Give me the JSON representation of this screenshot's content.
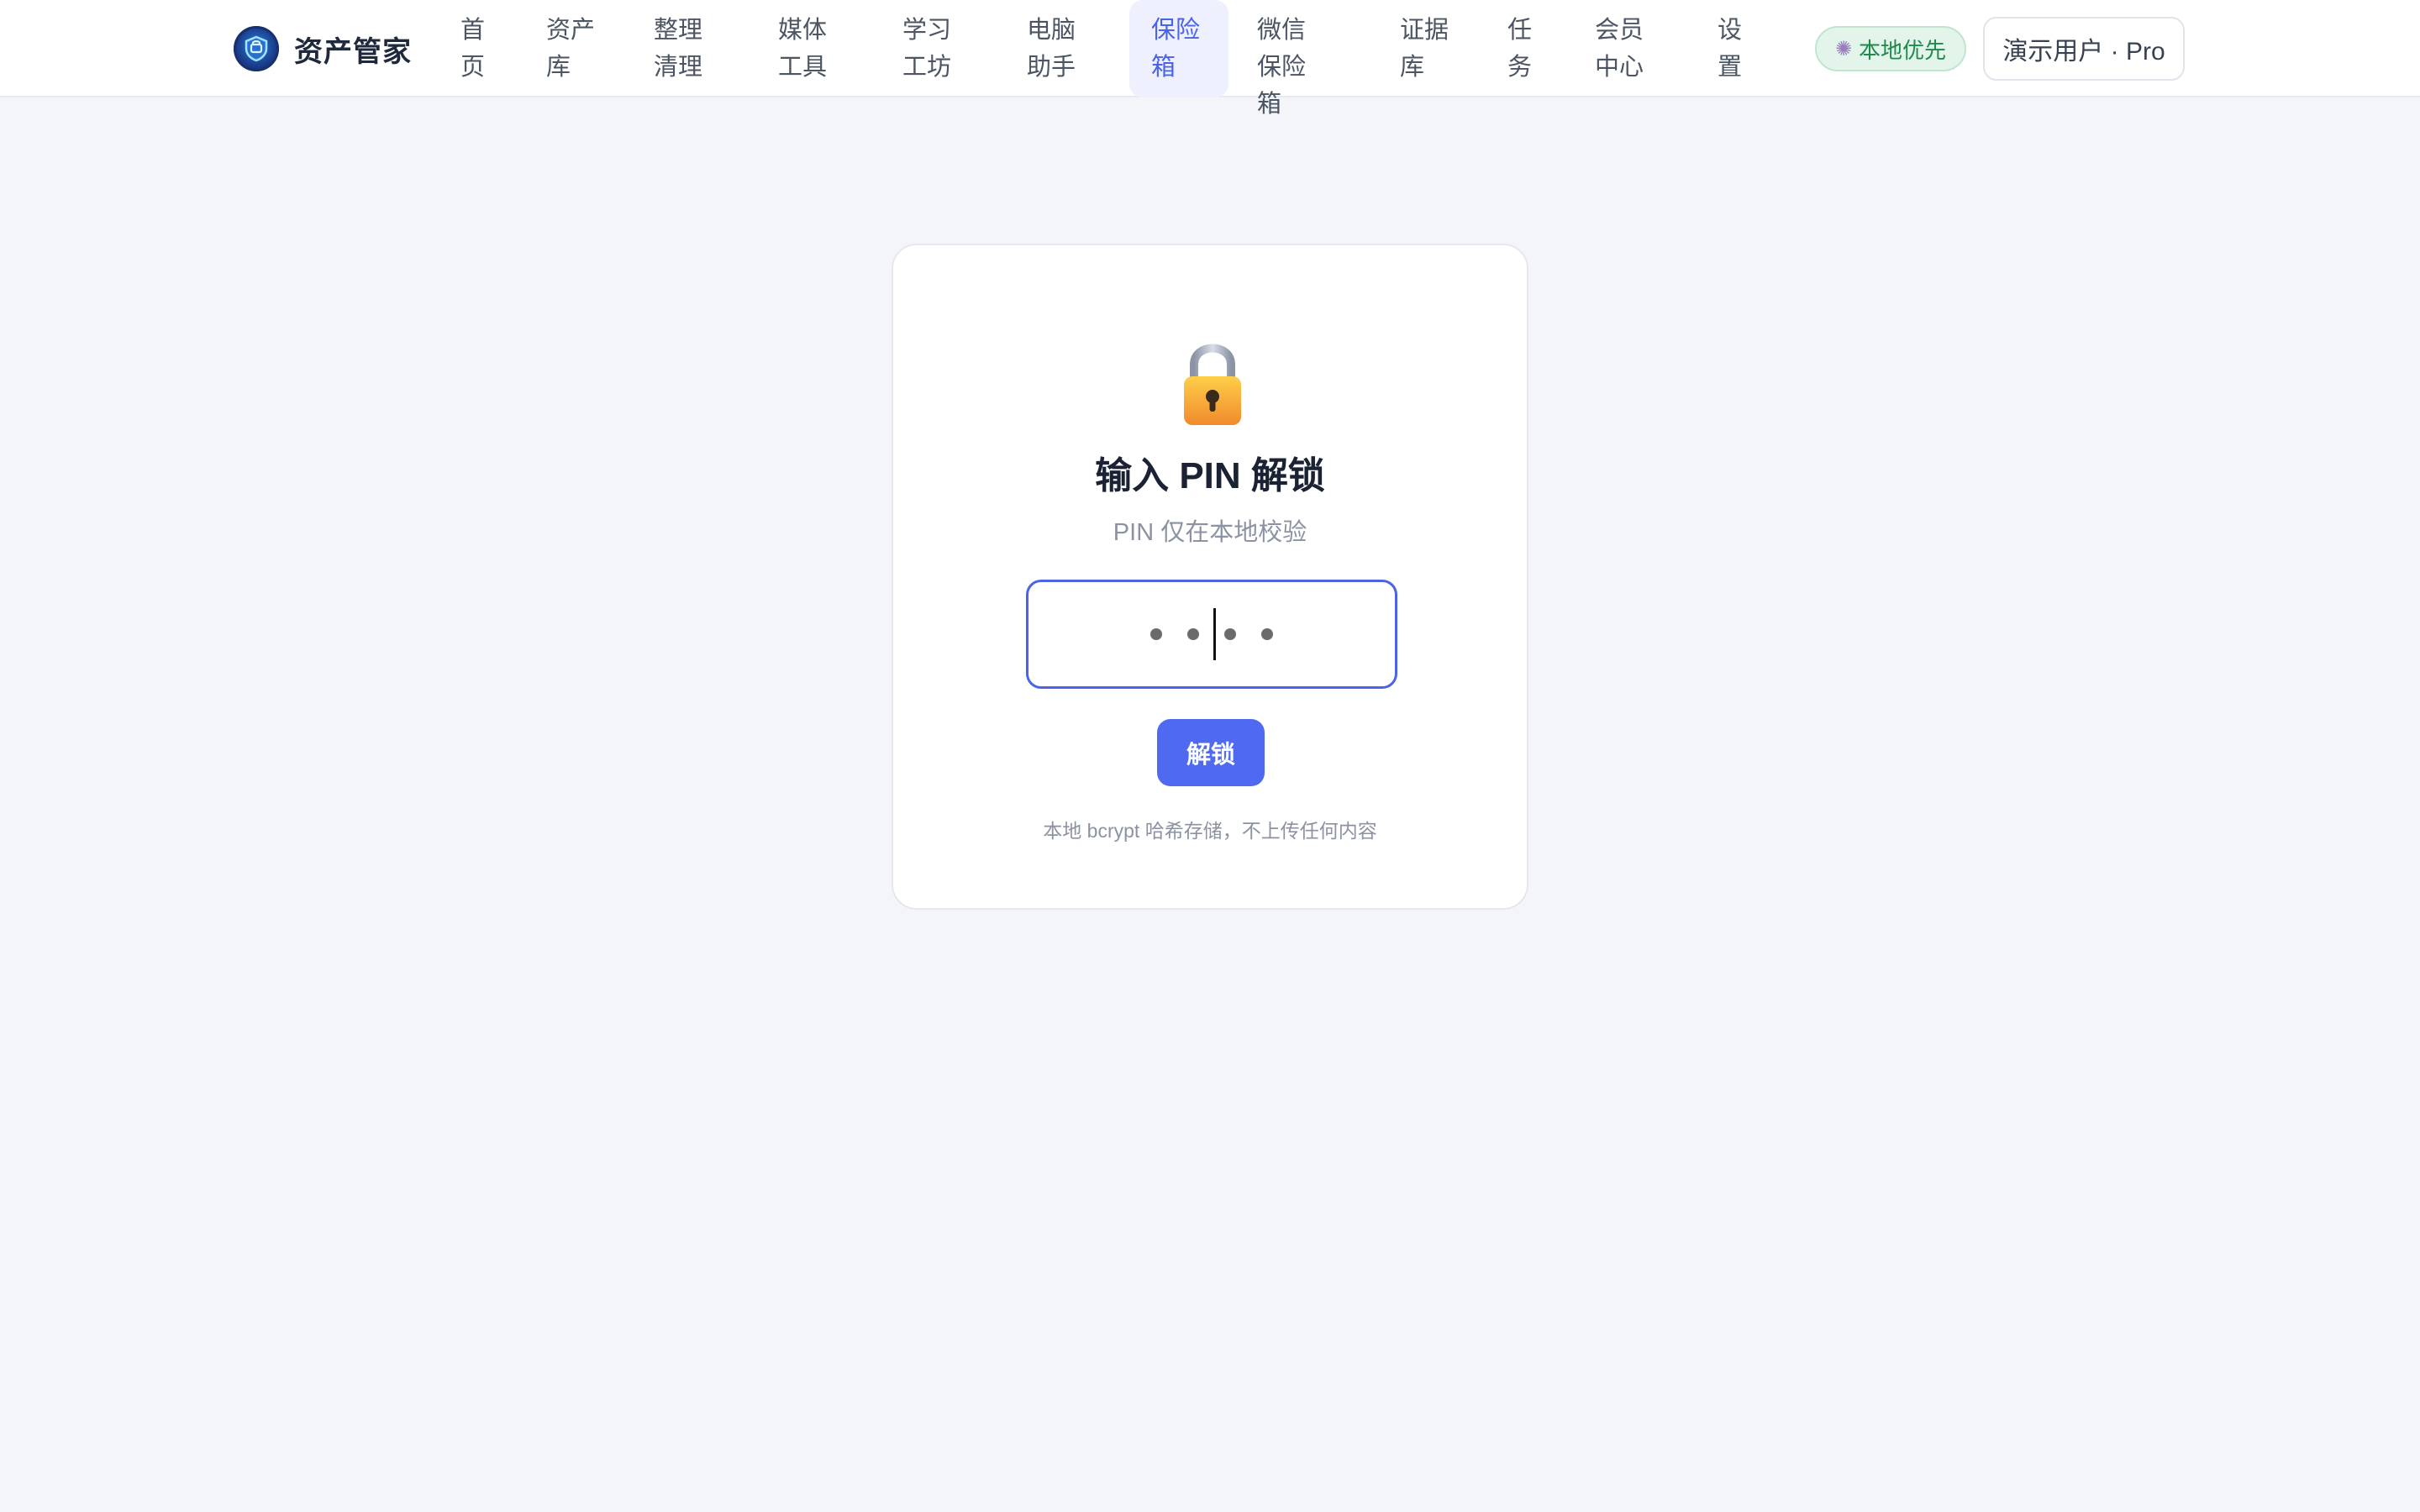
{
  "app": {
    "name": "资产管家"
  },
  "nav": {
    "items": [
      {
        "label": "首页"
      },
      {
        "label": "资产库"
      },
      {
        "label": "整理清理"
      },
      {
        "label": "媒体工具"
      },
      {
        "label": "学习工坊"
      },
      {
        "label": "电脑助手"
      },
      {
        "label": "保险箱",
        "active": true
      },
      {
        "label": "微信保险箱"
      },
      {
        "label": "证据库"
      },
      {
        "label": "任务"
      },
      {
        "label": "会员中心"
      },
      {
        "label": "设置"
      }
    ]
  },
  "header": {
    "local_badge": "本地优先",
    "user_label": "演示用户 · Pro"
  },
  "vault": {
    "title": "输入 PIN 解锁",
    "subtitle": "PIN 仅在本地校验",
    "pin_length": 4,
    "unlock_label": "解锁",
    "footnote": "本地 bcrypt 哈希存储，不上传任何内容"
  },
  "colors": {
    "accent": "#4f6af0",
    "active_nav_bg": "#eef1fd",
    "badge_green": "#1f8a4c",
    "page_bg": "#f4f5f9"
  },
  "icons": {
    "logo": "shield-logo-icon",
    "badge": "gear-icon",
    "lock": "lock-icon"
  }
}
